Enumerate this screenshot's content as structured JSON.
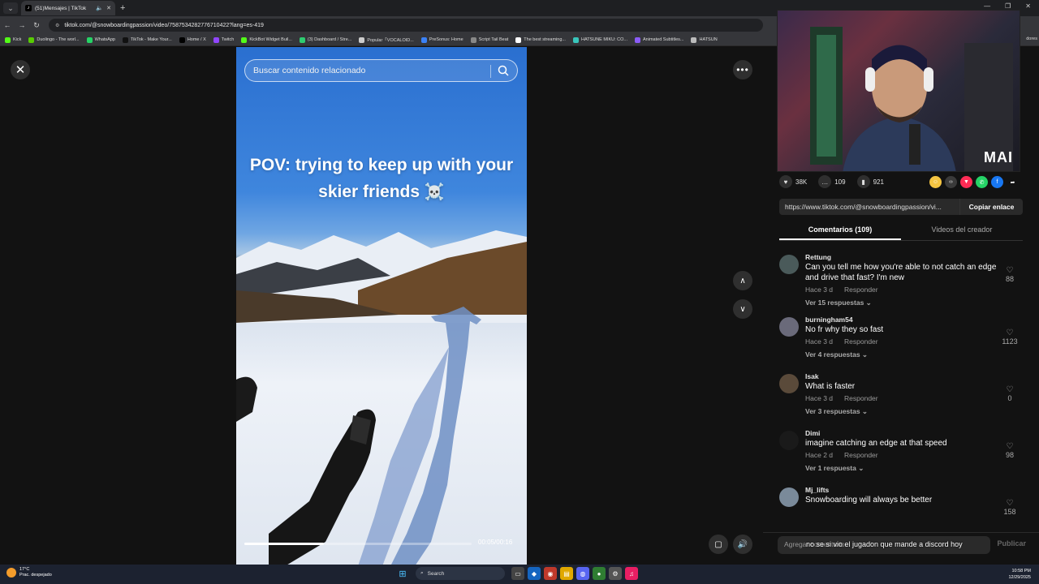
{
  "browser": {
    "tab_title": "(51)Mensajes | TikTok",
    "url": "tiktok.com/@snowboardingpassion/video/7587534282776710422?lang=es-419",
    "bookmarks": [
      {
        "label": "Kick",
        "color": "#53fc18"
      },
      {
        "label": "Duolingo - The worl...",
        "color": "#58cc02"
      },
      {
        "label": "WhatsApp",
        "color": "#25d366"
      },
      {
        "label": "TikTok - Make Your...",
        "color": "#111111"
      },
      {
        "label": "Home / X",
        "color": "#000000"
      },
      {
        "label": "Twitch",
        "color": "#9146ff"
      },
      {
        "label": "KickBot Widget Buil...",
        "color": "#53fc18"
      },
      {
        "label": "(3) Dashboard / Stre...",
        "color": "#2ecc71"
      },
      {
        "label": "Popular「VOCALOID...",
        "color": "#cccccc"
      },
      {
        "label": "PreSonus: Home",
        "color": "#3b82f6"
      },
      {
        "label": "Script Tail Beat",
        "color": "#888888"
      },
      {
        "label": "The best streaming...",
        "color": "#ffffff"
      },
      {
        "label": "HATSUNE MIKU: CO...",
        "color": "#39c5bb"
      },
      {
        "label": "Animated Subtitles...",
        "color": "#8b5cf6"
      },
      {
        "label": "HATSUN",
        "color": "#bbbbbb"
      }
    ],
    "bookmarks_more": "dores"
  },
  "video": {
    "search_placeholder": "Buscar contenido relacionado",
    "caption_line1": "POV: trying to keep up with your",
    "caption_line2": "skier friends",
    "caption_emoji": "☠️",
    "time": "00:05/00:16",
    "progress": 0.35
  },
  "webcam": {
    "tag": "MAI"
  },
  "actions": {
    "likes": "38K",
    "comments": "109",
    "saves": "921"
  },
  "share_colors": [
    "#f5c542",
    "#3a3a3a",
    "#fe2c55",
    "#25d366",
    "#1877f2"
  ],
  "link": {
    "url": "https://www.tiktok.com/@snowboardingpassion/vi...",
    "copy_label": "Copiar enlace"
  },
  "tabs": {
    "comments": "Comentarios (109)",
    "creator_videos": "Videos del creador"
  },
  "comments": [
    {
      "user": "Rettung",
      "text": "Can you tell me how you're able to not catch an edge and drive that fast? I'm new",
      "time": "Hace 3 d",
      "reply": "Responder",
      "replies": "Ver 15 respuestas ⌄",
      "likes": "88",
      "avatar": "#4a5a5a"
    },
    {
      "user": "burningham54",
      "text": "No fr why they so fast",
      "time": "Hace 3 d",
      "reply": "Responder",
      "replies": "Ver 4 respuestas ⌄",
      "likes": "1123",
      "avatar": "#6a6a7a"
    },
    {
      "user": "Isak",
      "text": "What is faster",
      "time": "Hace 3 d",
      "reply": "Responder",
      "replies": "Ver 3 respuestas ⌄",
      "likes": "0",
      "avatar": "#5a4a3a"
    },
    {
      "user": "Dimi",
      "text": "imagine catching an edge at that speed",
      "time": "Hace 2 d",
      "reply": "Responder",
      "replies": "Ver 1 respuesta ⌄",
      "likes": "98",
      "avatar": "#1a1a1a"
    },
    {
      "user": "Mj_lifts",
      "text": "Snowboarding will always be better",
      "time": "",
      "reply": "",
      "replies": "",
      "likes": "158",
      "avatar": "#7a8a9a"
    }
  ],
  "comment_input": {
    "placeholder": "Agregar comentario...",
    "post": "Publicar"
  },
  "chat_overlay": {
    "message": "no se si vio el jugadon que mande a discord hoy"
  },
  "taskbar": {
    "temp": "17°C",
    "weather": "Prac. despejado",
    "search": "Search",
    "time": "10:58 PM",
    "date": "12/29/2025"
  }
}
